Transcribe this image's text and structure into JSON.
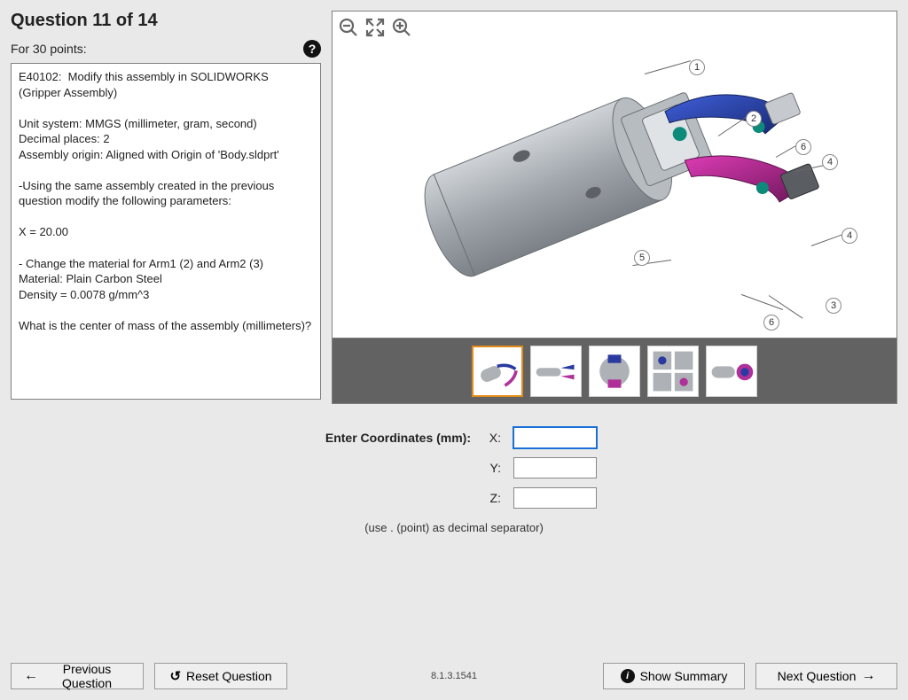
{
  "question": {
    "title": "Question 11 of 14",
    "points_label": "For 30 points:",
    "body": "E40102:  Modify this assembly in SOLIDWORKS (Gripper Assembly)\n\nUnit system: MMGS (millimeter, gram, second)\nDecimal places: 2\nAssembly origin: Aligned with Origin of 'Body.sldprt'\n\n-Using the same assembly created in the previous question modify the following parameters:\n\nX = 20.00\n\n- Change the material for Arm1 (2) and Arm2 (3)\nMaterial: Plain Carbon Steel\nDensity = 0.0078 g/mm^3\n\nWhat is the center of mass of the assembly (millimeters)?"
  },
  "viewer": {
    "toolbar": {
      "zoom_out": "Zoom Out",
      "fit": "Fit",
      "zoom_in": "Zoom In"
    },
    "callouts": [
      "1",
      "2",
      "3",
      "4",
      "4",
      "5",
      "6",
      "6"
    ],
    "thumbs": [
      {
        "selected": true,
        "label": "iso"
      },
      {
        "selected": false,
        "label": "side"
      },
      {
        "selected": false,
        "label": "top"
      },
      {
        "selected": false,
        "label": "multi"
      },
      {
        "selected": false,
        "label": "alt"
      }
    ]
  },
  "answer": {
    "prompt": "Enter Coordinates (mm):",
    "axes": {
      "x": "X:",
      "y": "Y:",
      "z": "Z:"
    },
    "values": {
      "x": "",
      "y": "",
      "z": ""
    },
    "hint": "(use . (point) as decimal separator)"
  },
  "footer": {
    "prev": "Previous Question",
    "reset": "Reset Question",
    "version": "8.1.3.1541",
    "summary": "Show Summary",
    "next": "Next Question"
  }
}
